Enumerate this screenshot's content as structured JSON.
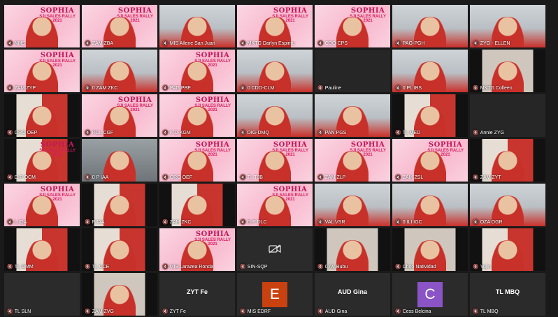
{
  "brand": {
    "line1": "SOPHIA",
    "line2": "SJI SALES RALLY",
    "line3": "2021"
  },
  "tiles": [
    {
      "name": "NMS",
      "style": "pink",
      "brand": true
    },
    {
      "name": "ZAM ZBA",
      "style": "pink",
      "brand": true
    },
    {
      "name": "MIS Allene San Juan",
      "style": "room"
    },
    {
      "name": "MKTG Darlyn Espiritu",
      "style": "pink",
      "brand": true
    },
    {
      "name": "CDO-CPS",
      "style": "pink",
      "brand": true
    },
    {
      "name": "PAG-PGH",
      "style": "room"
    },
    {
      "name": "ZYG - ELLEN",
      "style": "room"
    },
    {
      "name": "ZAM ZYP",
      "style": "pink",
      "brand": true
    },
    {
      "name": "0 ZAM ZKC",
      "style": "room"
    },
    {
      "name": "PAG PBE",
      "style": "pink",
      "brand": true
    },
    {
      "name": "0 CDO-CLM",
      "style": "room"
    },
    {
      "name": "Pauline",
      "style": "dark"
    },
    {
      "name": "0 PL IBS",
      "style": "room"
    },
    {
      "name": "MKTG Colleen",
      "style": "pillar"
    },
    {
      "name": "ORO OEP",
      "style": "pillar redbody"
    },
    {
      "name": "POL CGF",
      "style": "pink",
      "brand": true
    },
    {
      "name": "K D-KGM",
      "style": "pink",
      "brand": true
    },
    {
      "name": "DIG-DMQ",
      "style": "room"
    },
    {
      "name": "PAN PGS",
      "style": "room"
    },
    {
      "name": "TL MED",
      "style": "pillar redbody"
    },
    {
      "name": "Annie ZYG",
      "style": "dark"
    },
    {
      "name": "D-P OCM",
      "style": "pillar redbody",
      "brand": true
    },
    {
      "name": "0 P IAA",
      "style": "blur"
    },
    {
      "name": "ORO OEF",
      "style": "pink",
      "brand": true
    },
    {
      "name": "TL TJB",
      "style": "pink",
      "brand": true
    },
    {
      "name": "ZAM ZLP",
      "style": "pink",
      "brand": true
    },
    {
      "name": "ZAM ZSL",
      "style": "pink",
      "brand": true
    },
    {
      "name": "ZAM ZYT",
      "style": "pillar redbody"
    },
    {
      "name": "L IQA",
      "style": "pink",
      "brand": true
    },
    {
      "name": "P IAA",
      "style": "pillar redbody"
    },
    {
      "name": "ZAM ZKC",
      "style": "pillar redbody"
    },
    {
      "name": "D-P DLC",
      "style": "pink",
      "brand": true
    },
    {
      "name": "VAL VSR",
      "style": "room"
    },
    {
      "name": "0 ILI IGC",
      "style": "room"
    },
    {
      "name": "OZA OGR",
      "style": "room"
    },
    {
      "name": "TL OMM",
      "style": "pillar redbody"
    },
    {
      "name": "TL CCE",
      "style": "pillar redbody"
    },
    {
      "name": "MIS Larazea Ronda",
      "style": "pink",
      "brand": true
    },
    {
      "name": "SIN-SQP",
      "style": "cam",
      "camoff": true
    },
    {
      "name": "0 AV Bubu",
      "style": "pillar"
    },
    {
      "name": "Choo Natividad",
      "style": "pillar"
    },
    {
      "name": "Yujin",
      "style": "pillar redbody"
    },
    {
      "name": "TL SLN",
      "style": "cam"
    },
    {
      "name": "ZAM ZVG",
      "style": "pillar"
    },
    {
      "name": "ZYT Fe",
      "style": "cam",
      "center": "ZYT Fe"
    },
    {
      "name": "MIS EDRF",
      "style": "cam",
      "avatar": "E",
      "avatar_color": "#c9410f"
    },
    {
      "name": "AUD Gina",
      "style": "cam",
      "center": "AUD Gina"
    },
    {
      "name": "Cess Belcina",
      "style": "cam",
      "avatar": "C",
      "avatar_color": "#8a54c7"
    },
    {
      "name": "TL MBQ",
      "style": "cam",
      "center": "TL MBQ"
    }
  ]
}
